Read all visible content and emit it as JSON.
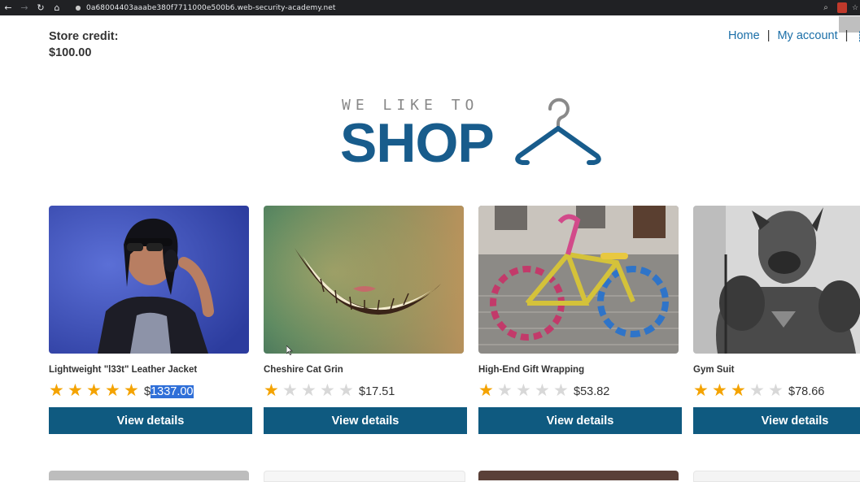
{
  "browser": {
    "url": "0a68004403aaabe380f7711000e500b6.web-security-academy.net"
  },
  "header": {
    "store_credit_label": "Store credit:",
    "store_credit_value": "$100.00",
    "nav": {
      "home": "Home",
      "separator": "|",
      "my_account": "My account"
    }
  },
  "logo": {
    "tagline": "WE LIKE TO",
    "word": "SHOP"
  },
  "products": [
    {
      "name": "Lightweight \"l33t\" Leather Jacket",
      "rating": 5,
      "price_currency": "$",
      "price_amount": "1337.00",
      "button": "View details"
    },
    {
      "name": "Cheshire Cat Grin",
      "rating": 1,
      "price": "$17.51",
      "button": "View details"
    },
    {
      "name": "High-End Gift Wrapping",
      "rating": 1,
      "price": "$53.82",
      "button": "View details"
    },
    {
      "name": "Gym Suit",
      "rating": 3,
      "price": "$78.66",
      "button": "View details"
    }
  ],
  "colors": {
    "accent": "#0f5a80",
    "link": "#1b6fa8",
    "star": "#f4a300",
    "selection": "#2f6fd8"
  }
}
